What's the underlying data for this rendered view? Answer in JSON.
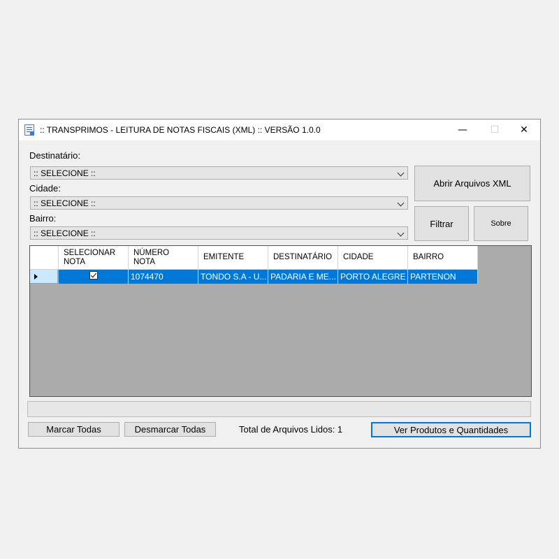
{
  "window": {
    "title": ":: TRANSPRIMOS - LEITURA DE NOTAS FISCAIS (XML) :: VERSÃO 1.0.0",
    "minimize": "—",
    "maximize": "☐",
    "close": "✕"
  },
  "filters": {
    "destinatario_label": "Destinatário:",
    "destinatario_value": ":: SELECIONE ::",
    "cidade_label": "Cidade:",
    "cidade_value": ":: SELECIONE ::",
    "bairro_label": "Bairro:",
    "bairro_value": ":: SELECIONE ::"
  },
  "buttons": {
    "abrir": "Abrir Arquivos XML",
    "filtrar": "Filtrar",
    "sobre": "Sobre",
    "marcar": "Marcar Todas",
    "desmarcar": "Desmarcar Todas",
    "ver_produtos": "Ver Produtos e Quantidades"
  },
  "grid": {
    "columns": [
      [
        "SELECIONAR",
        "NOTA"
      ],
      [
        "NÚMERO",
        "NOTA"
      ],
      [
        "EMITENTE"
      ],
      [
        "DESTINATÁRIO"
      ],
      [
        "CIDADE"
      ],
      [
        "BAIRRO"
      ]
    ],
    "rows": [
      {
        "selected": true,
        "numero": "1074470",
        "emitente": "TONDO S.A - U...",
        "destinatario": "PADARIA E ME...",
        "cidade": "PORTO ALEGRE",
        "bairro": "PARTENON"
      }
    ]
  },
  "status": {
    "total_label": "Total de Arquivos Lidos: 1"
  },
  "icons": {
    "app": "document-edit-icon",
    "dropdown": "chevron-down-icon",
    "row_pointer": "triangle-right-icon",
    "checkbox": "checkbox-checked-icon"
  },
  "colors": {
    "selection": "#0078d7",
    "row_header_selected": "#cce8ff",
    "grid_background": "#ababab",
    "window_background": "#f0f0f0"
  }
}
